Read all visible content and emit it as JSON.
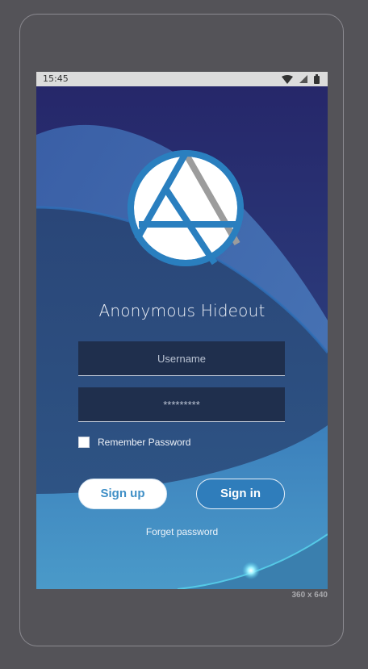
{
  "status_bar": {
    "time": "15:45",
    "icons": [
      "wifi-icon",
      "signal-icon",
      "battery-icon"
    ]
  },
  "app": {
    "title": "Anonymous Hideout"
  },
  "form": {
    "username_placeholder": "Username",
    "username_value": "",
    "password_value": "*********",
    "remember_label": "Remember Password",
    "remember_checked": false
  },
  "buttons": {
    "signup_label": "Sign up",
    "signin_label": "Sign in",
    "forget_label": "Forget password"
  },
  "device": {
    "size_label": "360 x 640"
  },
  "colors": {
    "background": "#545358",
    "accent": "#2f7dbb",
    "field": "#1f2f4d"
  }
}
